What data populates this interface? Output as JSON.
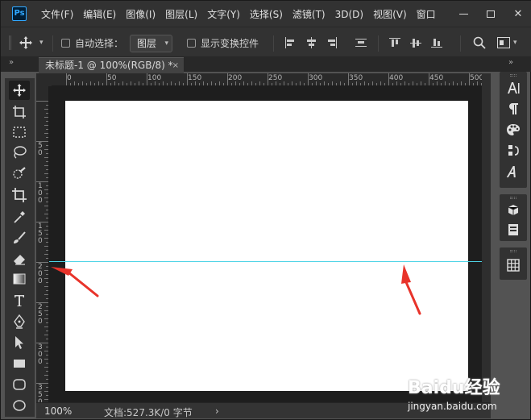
{
  "app": {
    "logo": "Ps"
  },
  "menu": [
    "文件(F)",
    "编辑(E)",
    "图像(I)",
    "图层(L)",
    "文字(Y)",
    "选择(S)",
    "滤镜(T)",
    "3D(D)",
    "视图(V)",
    "窗口"
  ],
  "window_controls": {
    "close_glyph": "✕"
  },
  "options_bar": {
    "auto_select_label": "自动选择：",
    "layer_select_value": "图层",
    "show_transform_label": "显示变换控件"
  },
  "panel_chevrons": "»",
  "document_tab": {
    "title": "未标题-1 @ 100%(RGB/8) *",
    "close_glyph": "×"
  },
  "ruler_top_labels": [
    "0",
    "50",
    "100",
    "150",
    "200",
    "250",
    "300",
    "350",
    "400",
    "450",
    "500"
  ],
  "ruler_left_labels": [
    {
      "text": "50"
    },
    {
      "text": "100"
    },
    {
      "text": "150"
    },
    {
      "text": "200"
    },
    {
      "text": "250"
    },
    {
      "text": "300"
    },
    {
      "text": "350"
    }
  ],
  "status_bar": {
    "zoom": "100%",
    "doc_size": "文档:527.3K/0 字节",
    "arrow": "›"
  },
  "tools": [
    "move-tool",
    "artboard-tool",
    "marquee-tool",
    "lasso-tool",
    "quick-select-tool",
    "crop-tool",
    "eyedropper-tool",
    "brush-tool",
    "eraser-tool",
    "gradient-tool",
    "type-tool",
    "pen-tool",
    "path-select-tool",
    "rectangle-tool",
    "rounded-rect-tool",
    "ellipse-tool"
  ],
  "right_panel_icons": [
    "character-icon",
    "paragraph-icon",
    "swatches-icon",
    "glyph-path-icon",
    "glyphs-icon",
    "3d-icon",
    "properties-icon",
    "grid-icon"
  ],
  "watermark": {
    "brand": "Baidu经验",
    "url": "jingyan.baidu.com"
  },
  "colors": {
    "guide": "#4ed4e6",
    "annotation_arrow": "#e8332a",
    "app_bg": "#535353",
    "canvas": "#ffffff"
  }
}
